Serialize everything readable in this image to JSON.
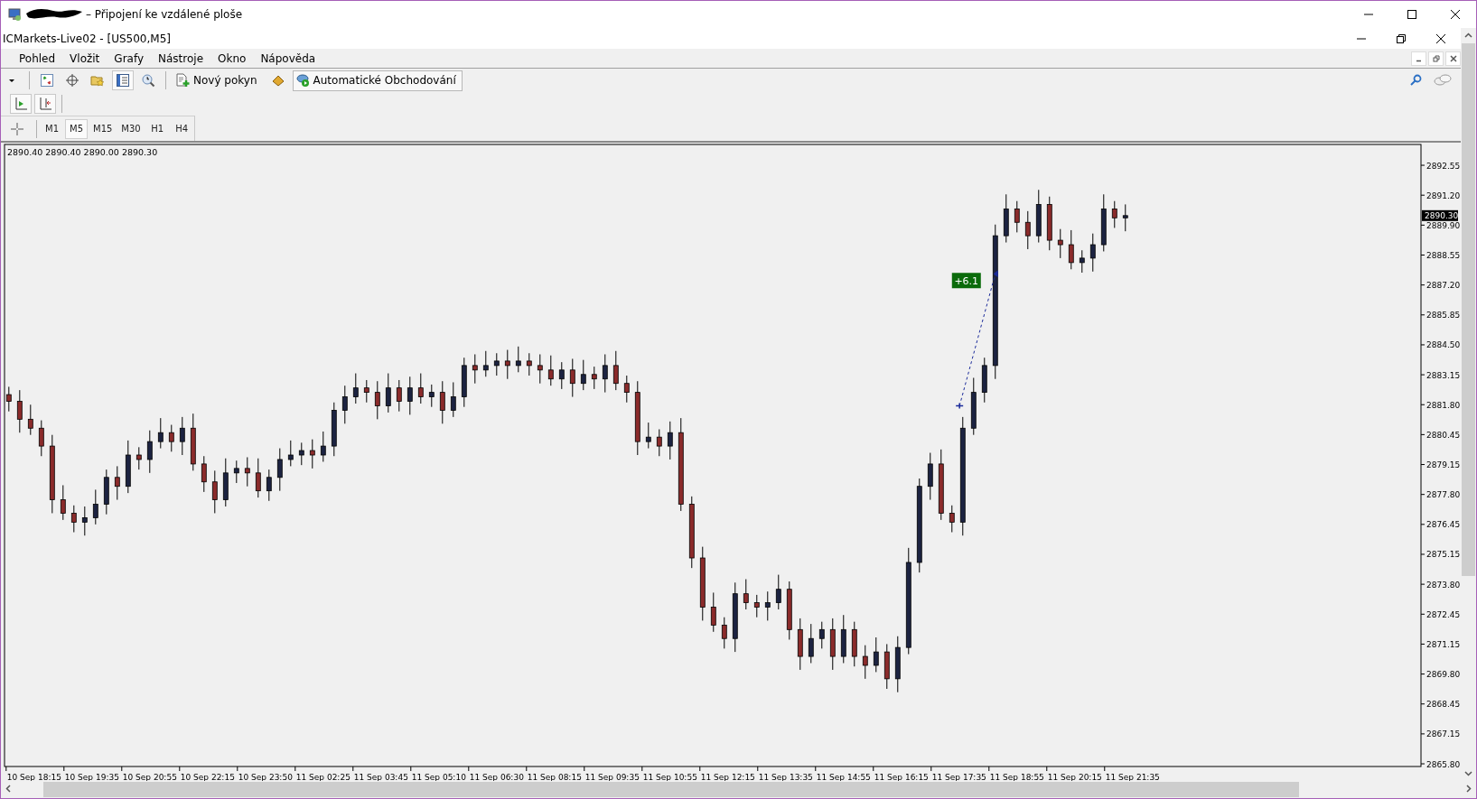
{
  "remote_window": {
    "title": "– Připojení ke vzdálené ploše"
  },
  "app": {
    "title": "ICMarkets-Live02 - [US500,M5]"
  },
  "menu": [
    "Pohled",
    "Vložit",
    "Grafy",
    "Nástroje",
    "Okno",
    "Nápověda"
  ],
  "toolbar": {
    "new_order": "Nový pokyn",
    "auto_trading": {
      "label": "Automatické Obchodování",
      "on": true
    }
  },
  "timeframes": [
    {
      "label": "M1",
      "selected": false
    },
    {
      "label": "M5",
      "selected": true
    },
    {
      "label": "M15",
      "selected": false
    },
    {
      "label": "M30",
      "selected": false
    },
    {
      "label": "H1",
      "selected": false
    },
    {
      "label": "H4",
      "selected": false
    }
  ],
  "chart": {
    "ohlc": "2890.40 2890.40 2890.00 2890.30",
    "current_price": "2890.30",
    "change_badge": "+6.1",
    "price_axis": [
      "2892.55",
      "2891.20",
      "2889.90",
      "2888.55",
      "2887.20",
      "2885.85",
      "2884.50",
      "2883.15",
      "2881.80",
      "2880.45",
      "2879.15",
      "2877.80",
      "2876.45",
      "2875.15",
      "2873.80",
      "2872.45",
      "2871.15",
      "2869.80",
      "2868.45",
      "2867.15",
      "2865.80"
    ],
    "time_axis": [
      "10 Sep 18:15",
      "10 Sep 19:35",
      "10 Sep 20:55",
      "10 Sep 22:15",
      "10 Sep 23:50",
      "11 Sep 02:25",
      "11 Sep 03:45",
      "11 Sep 05:10",
      "11 Sep 06:30",
      "11 Sep 08:15",
      "11 Sep 09:35",
      "11 Sep 10:55",
      "11 Sep 12:15",
      "11 Sep 13:35",
      "11 Sep 14:55",
      "11 Sep 16:15",
      "11 Sep 17:35",
      "11 Sep 18:55",
      "11 Sep 20:15",
      "11 Sep 21:35"
    ]
  }
}
